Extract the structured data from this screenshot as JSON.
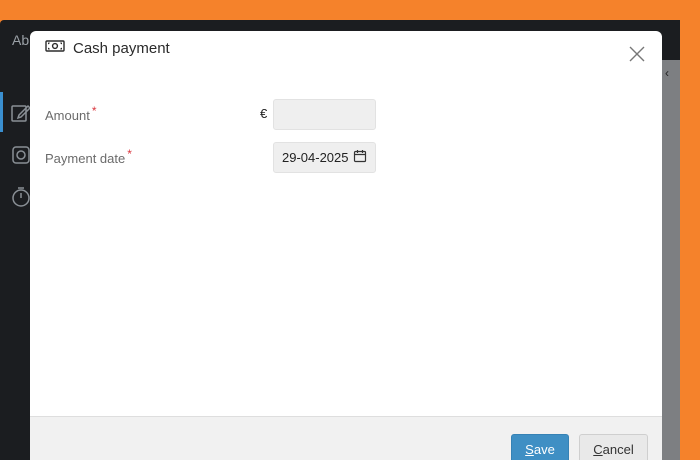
{
  "app": {
    "topbar_text": "Ab"
  },
  "modal": {
    "title": "Cash payment",
    "title_icon": "cash-icon",
    "close_icon": "close-icon"
  },
  "form": {
    "amount": {
      "label": "Amount",
      "required_mark": "*",
      "currency": "€",
      "value": ""
    },
    "payment_date": {
      "label": "Payment date",
      "required_mark": "*",
      "value": "29-04-2025",
      "icon": "calendar-icon"
    }
  },
  "footer": {
    "save": {
      "accesskey": "S",
      "rest": "ave"
    },
    "cancel": {
      "accesskey": "C",
      "rest": "ancel"
    }
  },
  "colors": {
    "frame": "#f5822b",
    "primary": "#3f8fc4",
    "required": "#d9363e"
  }
}
